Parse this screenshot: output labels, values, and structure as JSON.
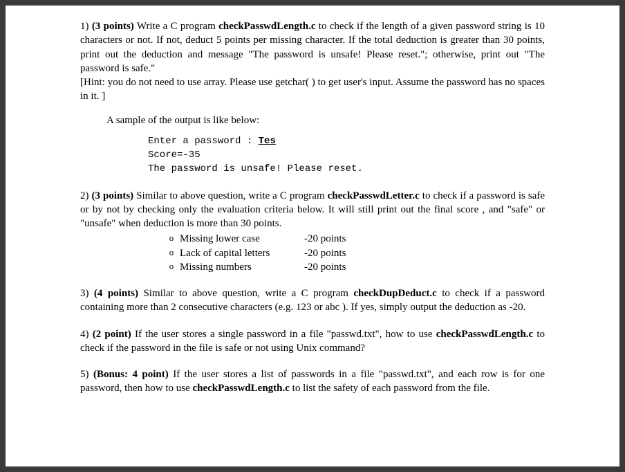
{
  "q1": {
    "num": "1)",
    "points": "(3 points)",
    "text_a": " Write a C program ",
    "prog": "checkPasswdLength.c",
    "text_b": " to check if the length of a given password string is 10 characters or not. If not, deduct 5 points per missing character. If the total deduction is greater than 30 points, print out the deduction and message \"The password is unsafe! Please reset.\"; otherwise, print out \"The password is safe.\"",
    "hint": "[Hint: you do not need to use array. Please use getchar( ) to get user's input. Assume the password has no spaces in it. ]",
    "sample_intro": "A sample of the output is like below:",
    "code": {
      "line1_prompt": "Enter a password : ",
      "line1_input": "Tes",
      "line2": "Score=-35",
      "line3": "The password is unsafe! Please reset."
    }
  },
  "q2": {
    "num": "2)",
    "points": "(3 points)",
    "text_a": " Similar to above question, write a C program ",
    "prog": "checkPasswdLetter.c",
    "text_b": " to check if a password is safe or by not by checking only the evaluation criteria below. It will still print out the final score , and \"safe\" or \"unsafe\" when deduction is more than 30 points.",
    "criteria": [
      {
        "label": "Missing lower case",
        "points": "-20 points"
      },
      {
        "label": "Lack of capital letters",
        "points": "-20 points"
      },
      {
        "label": "Missing numbers",
        "points": "-20 points"
      }
    ]
  },
  "q3": {
    "num": "3)",
    "points": "(4 points)",
    "text_a": " Similar to above question, write a C program ",
    "prog": "checkDupDeduct.c",
    "text_b": " to check if a password containing more than 2 consecutive characters (e.g. 123 or abc ). If yes, simply output the deduction as -20."
  },
  "q4": {
    "num": " 4)",
    "points": "(2 point)",
    "text_a": " If the user stores a single password in a file \"passwd.txt\", how to use ",
    "prog": "checkPasswdLength.c",
    "text_b": " to check if the password in the file is safe or not using Unix command?"
  },
  "q5": {
    "num": "5)",
    "points": "(Bonus: 4 point)",
    "text_a": " If the user stores a list of passwords in a file \"passwd.txt\", and each row is for one password, then how to use ",
    "prog": "checkPasswdLength.c",
    "text_b": " to list the safety of each password from the file."
  }
}
